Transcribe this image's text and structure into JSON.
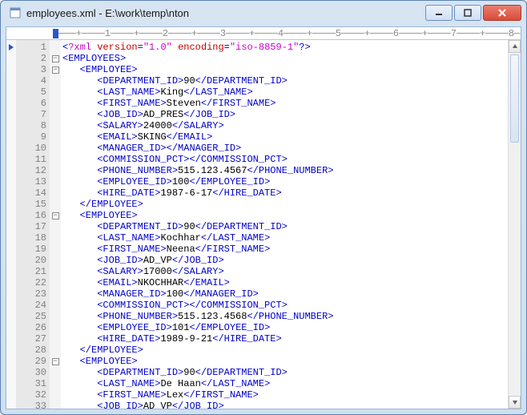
{
  "window": {
    "title": "employees.xml - E:\\work\\temp\\nton",
    "buttons": {
      "minimize": "minimize-button",
      "maximize": "maximize-button",
      "close": "close-button"
    }
  },
  "ruler": "·───+────1────+────2────+────3────+────4────+────5────+────6────+────7────+────8─",
  "editor": {
    "first_line": 1,
    "lines": [
      {
        "n": 1,
        "bm": true,
        "fold": "",
        "indent": 0,
        "kind": "decl",
        "decl": {
          "pre": "?xml ",
          "a1": "version",
          "v1": "\"1.0\"",
          "a2": "encoding",
          "v2": "\"iso-8859-1\""
        }
      },
      {
        "n": 2,
        "fold": "-",
        "indent": 0,
        "kind": "open",
        "tag": "EMPLOYEES"
      },
      {
        "n": 3,
        "fold": "-",
        "indent": 1,
        "kind": "open",
        "tag": "EMPLOYEE"
      },
      {
        "n": 4,
        "indent": 2,
        "kind": "leaf",
        "tag": "DEPARTMENT_ID",
        "text": "90"
      },
      {
        "n": 5,
        "indent": 2,
        "kind": "leaf",
        "tag": "LAST_NAME",
        "text": "King"
      },
      {
        "n": 6,
        "indent": 2,
        "kind": "leaf",
        "tag": "FIRST_NAME",
        "text": "Steven"
      },
      {
        "n": 7,
        "indent": 2,
        "kind": "leaf",
        "tag": "JOB_ID",
        "text": "AD_PRES"
      },
      {
        "n": 8,
        "indent": 2,
        "kind": "leaf",
        "tag": "SALARY",
        "text": "24000"
      },
      {
        "n": 9,
        "indent": 2,
        "kind": "leaf",
        "tag": "EMAIL",
        "text": "SKING"
      },
      {
        "n": 10,
        "indent": 2,
        "kind": "leaf",
        "tag": "MANAGER_ID",
        "text": ""
      },
      {
        "n": 11,
        "indent": 2,
        "kind": "leaf",
        "tag": "COMMISSION_PCT",
        "text": ""
      },
      {
        "n": 12,
        "indent": 2,
        "kind": "leaf",
        "tag": "PHONE_NUMBER",
        "text": "515.123.4567"
      },
      {
        "n": 13,
        "indent": 2,
        "kind": "leaf",
        "tag": "EMPLOYEE_ID",
        "text": "100"
      },
      {
        "n": 14,
        "indent": 2,
        "kind": "leaf",
        "tag": "HIRE_DATE",
        "text": "1987-6-17"
      },
      {
        "n": 15,
        "indent": 1,
        "kind": "close",
        "tag": "EMPLOYEE"
      },
      {
        "n": 16,
        "fold": "-",
        "indent": 1,
        "kind": "open",
        "tag": "EMPLOYEE"
      },
      {
        "n": 17,
        "indent": 2,
        "kind": "leaf",
        "tag": "DEPARTMENT_ID",
        "text": "90"
      },
      {
        "n": 18,
        "indent": 2,
        "kind": "leaf",
        "tag": "LAST_NAME",
        "text": "Kochhar"
      },
      {
        "n": 19,
        "indent": 2,
        "kind": "leaf",
        "tag": "FIRST_NAME",
        "text": "Neena"
      },
      {
        "n": 20,
        "indent": 2,
        "kind": "leaf",
        "tag": "JOB_ID",
        "text": "AD_VP"
      },
      {
        "n": 21,
        "indent": 2,
        "kind": "leaf",
        "tag": "SALARY",
        "text": "17000"
      },
      {
        "n": 22,
        "indent": 2,
        "kind": "leaf",
        "tag": "EMAIL",
        "text": "NKOCHHAR"
      },
      {
        "n": 23,
        "indent": 2,
        "kind": "leaf",
        "tag": "MANAGER_ID",
        "text": "100"
      },
      {
        "n": 24,
        "indent": 2,
        "kind": "leaf",
        "tag": "COMMISSION_PCT",
        "text": ""
      },
      {
        "n": 25,
        "indent": 2,
        "kind": "leaf",
        "tag": "PHONE_NUMBER",
        "text": "515.123.4568"
      },
      {
        "n": 26,
        "indent": 2,
        "kind": "leaf",
        "tag": "EMPLOYEE_ID",
        "text": "101"
      },
      {
        "n": 27,
        "indent": 2,
        "kind": "leaf",
        "tag": "HIRE_DATE",
        "text": "1989-9-21"
      },
      {
        "n": 28,
        "indent": 1,
        "kind": "close",
        "tag": "EMPLOYEE"
      },
      {
        "n": 29,
        "fold": "-",
        "indent": 1,
        "kind": "open",
        "tag": "EMPLOYEE"
      },
      {
        "n": 30,
        "indent": 2,
        "kind": "leaf",
        "tag": "DEPARTMENT_ID",
        "text": "90"
      },
      {
        "n": 31,
        "indent": 2,
        "kind": "leaf",
        "tag": "LAST_NAME",
        "text": "De Haan"
      },
      {
        "n": 32,
        "indent": 2,
        "kind": "leaf",
        "tag": "FIRST_NAME",
        "text": "Lex"
      },
      {
        "n": 33,
        "indent": 2,
        "kind": "leaf",
        "tag": "JOB_ID",
        "text": "AD_VP"
      }
    ]
  },
  "colors": {
    "tag": "#0000cc",
    "text": "#000000",
    "attr": "#c00000",
    "string": "#0099aa",
    "decl": "#c000c0"
  }
}
